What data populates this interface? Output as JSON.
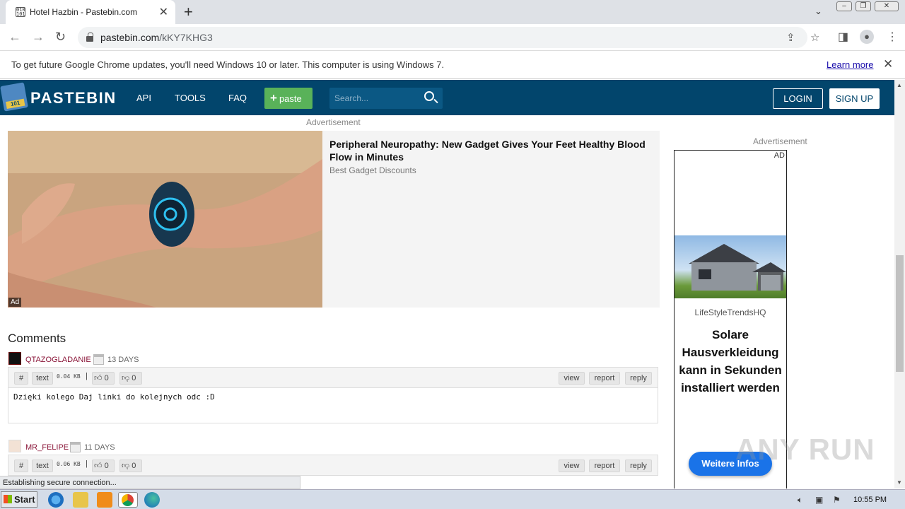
{
  "browser": {
    "tab_title": "Hotel Hazbin - Pastebin.com",
    "tab_favicon_text": "010 101",
    "url_host": "pastebin.com",
    "url_path": "/kKY7KHG3"
  },
  "infobar": {
    "message": "To get future Google Chrome updates, you'll need Windows 10 or later. This computer is using Windows 7.",
    "learn_more": "Learn more"
  },
  "pastebin": {
    "logo_text": "PASTEBIN",
    "logo_badge": "101",
    "nav": [
      "API",
      "TOOLS",
      "FAQ"
    ],
    "paste_button": "paste",
    "search_placeholder": "Search...",
    "login": "LOGIN",
    "signup": "SIGN UP"
  },
  "top_ad": {
    "label": "Advertisement",
    "headline": "Peripheral Neuropathy: New Gadget Gives Your Feet Healthy Blood Flow in Minutes",
    "source": "Best Gadget Discounts",
    "badge": "Ad"
  },
  "comments": {
    "title": "Comments",
    "items": [
      {
        "user": "QTAZOGLADANIE",
        "age": "13 DAYS",
        "hash": "#",
        "format": "text",
        "size": "0.04 KB",
        "sep": "|",
        "likes": "0",
        "dislikes": "0",
        "actions": [
          "view",
          "report",
          "reply"
        ],
        "text": "Dzięki kolego Daj linki do kolejnych odc :D"
      },
      {
        "user": "MR_FELIPE",
        "age": "11 DAYS",
        "hash": "#",
        "format": "text",
        "size": "0.06 KB",
        "sep": "|",
        "likes": "0",
        "dislikes": "0",
        "actions": [
          "view",
          "report",
          "reply"
        ],
        "text": ""
      }
    ]
  },
  "side_ad": {
    "label": "Advertisement",
    "mark": "AD",
    "brand": "LifeStyleTrendsHQ",
    "headline": "Solare Hausverkleidung kann in Sekunden installiert werden",
    "button": "Weitere Infos"
  },
  "status_text": "Establishing secure connection...",
  "watermark": "ANY RUN",
  "taskbar": {
    "start": "Start",
    "clock": "10:55 PM"
  },
  "colors": {
    "pastebin_header": "#02456c",
    "paste_button": "#59b259",
    "username": "#8a1538"
  }
}
